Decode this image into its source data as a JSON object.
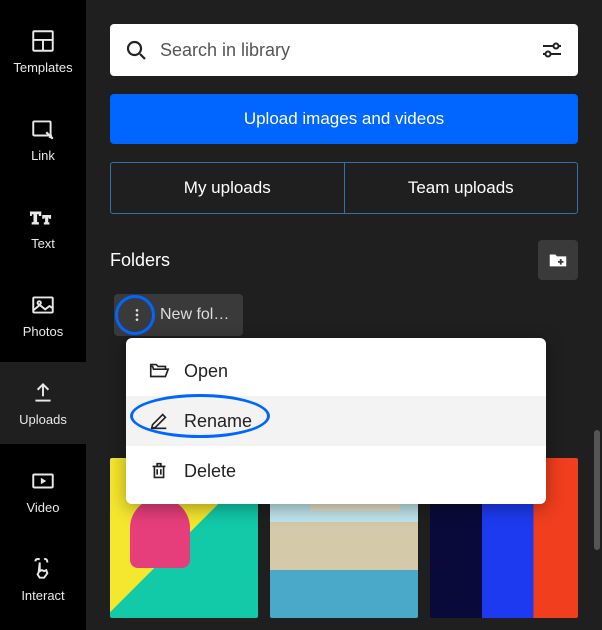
{
  "sidebar": {
    "items": [
      {
        "label": "Templates"
      },
      {
        "label": "Link"
      },
      {
        "label": "Text"
      },
      {
        "label": "Photos"
      },
      {
        "label": "Uploads"
      },
      {
        "label": "Video"
      },
      {
        "label": "Interact"
      }
    ]
  },
  "search": {
    "placeholder": "Search in library"
  },
  "upload_button": "Upload images and videos",
  "tabs": {
    "my": "My uploads",
    "team": "Team uploads"
  },
  "folders": {
    "title": "Folders",
    "items": [
      {
        "name": "New fol…"
      }
    ]
  },
  "context_menu": {
    "open": "Open",
    "rename": "Rename",
    "delete": "Delete"
  }
}
